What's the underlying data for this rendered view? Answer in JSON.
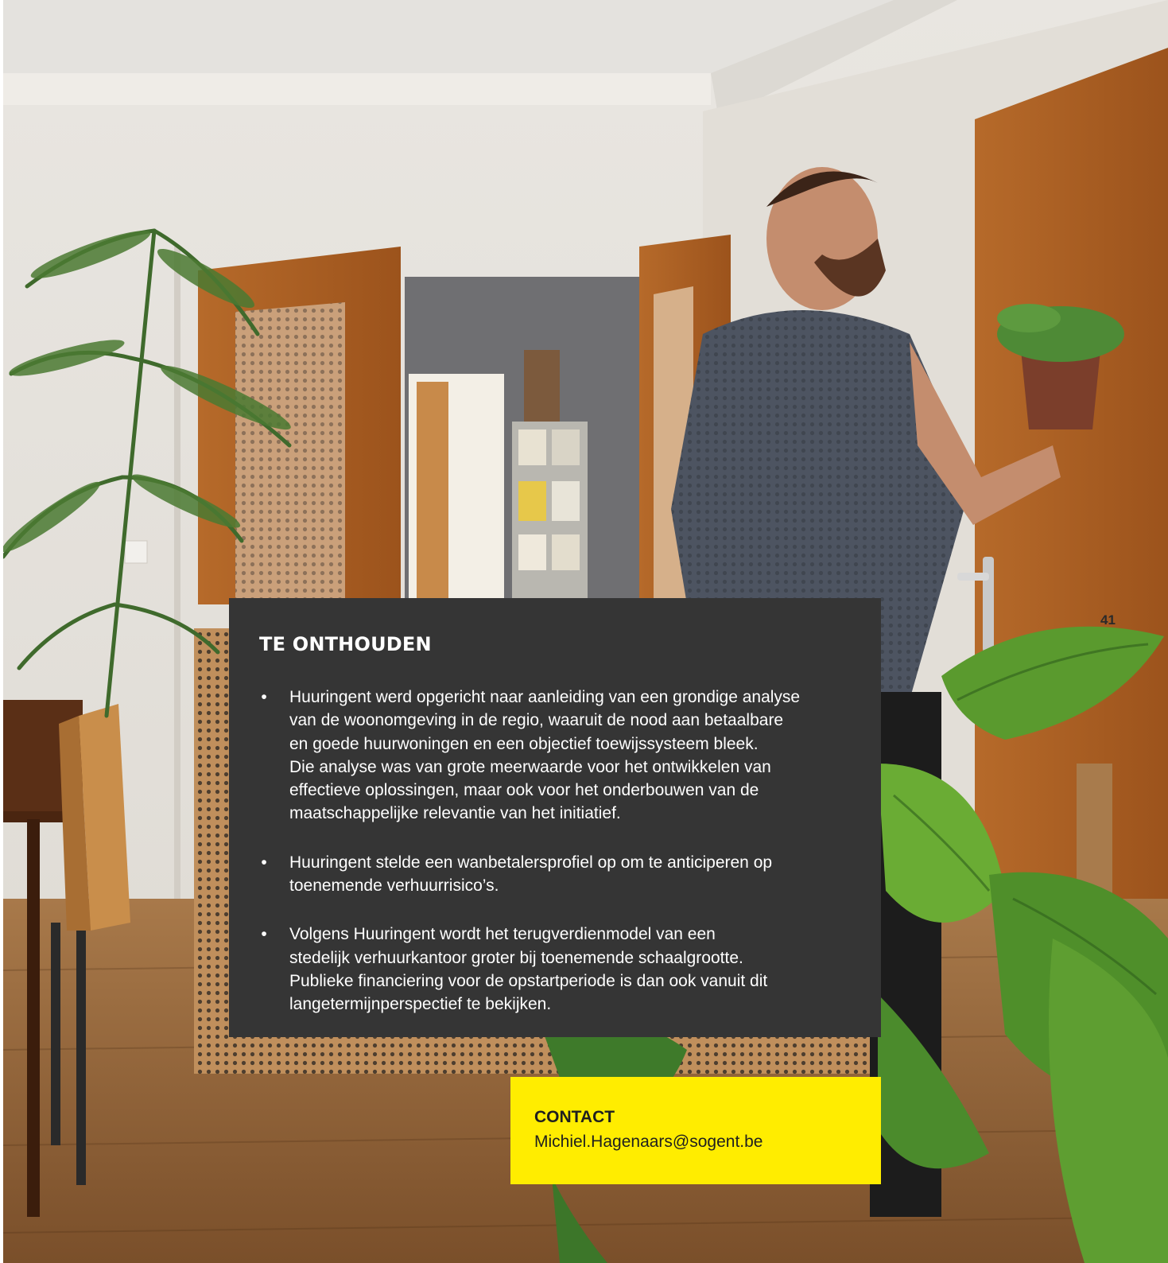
{
  "page": {
    "number": "41"
  },
  "photo": {
    "icons": [
      "palm-plant-icon",
      "monstera-plant-icon",
      "potted-plant-icon",
      "person-icon",
      "chair-icon",
      "table-icon",
      "door-icon",
      "postcard-rack-icon"
    ]
  },
  "summary": {
    "title": "TE ONTHOUDEN",
    "bullet_symbol": "•",
    "items": [
      {
        "paragraphs": [
          "Huuringent werd opgericht naar aanleiding van een grondige analyse\nvan de woonomgeving in de regio, waaruit de nood aan betaalbare\nen goede huurwoningen en een objectief toewijssysteem bleek.",
          "Die analyse was van grote meerwaarde voor het ontwikkelen van\neffectieve oplossingen, maar ook voor het onderbouwen van de\nmaatschappelijke relevantie van het initiatief."
        ]
      },
      {
        "paragraphs": [
          "Huuringent stelde een wanbetalersprofiel op om te anticiperen op\ntoenemende verhuurrisico’s."
        ]
      },
      {
        "paragraphs": [
          "Volgens Huuringent wordt het terugverdienmodel van een\nstedelijk verhuurkantoor groter bij toenemende schaalgrootte.\nPubliekе financiering voor de opstartperiode is dan ook vanuit dit\nlangetermijnperspectief te bekijken."
        ]
      }
    ]
  },
  "contact": {
    "label": "CONTACT",
    "email": "Michiel.Hagenaars@sogent.be"
  },
  "colors": {
    "panel_background": "#353535",
    "contact_background": "#ffed00",
    "text_light": "#ffffff",
    "text_dark": "#1f1f1f"
  }
}
